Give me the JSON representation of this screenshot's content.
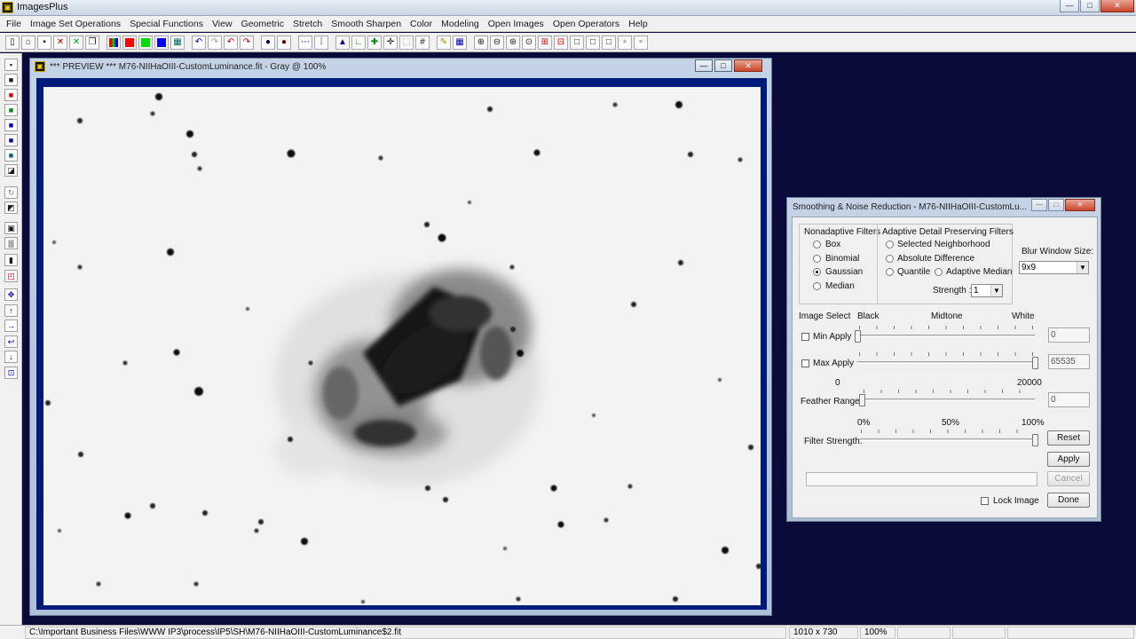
{
  "app": {
    "title": "ImagesPlus",
    "icon": "images-plus-logo-icon"
  },
  "menu": [
    "File",
    "Image Set Operations",
    "Special Functions",
    "View",
    "Geometric",
    "Stretch",
    "Smooth Sharpen",
    "Color",
    "Modeling",
    "Open Images",
    "Open Operators",
    "Help"
  ],
  "toolbar_colors": {
    "red": "#ff0000",
    "green": "#00dd00",
    "blue": "#0000ff"
  },
  "preview": {
    "title": "*** PREVIEW *** M76-NIIHaOIII-CustomLuminance.fit - Gray @ 100%"
  },
  "dialog": {
    "title": "Smoothing & Noise Reduction - M76-NIIHaOIII-CustomLu...",
    "nonadaptive": {
      "label": "Nonadaptive Filters",
      "options": [
        "Box",
        "Binomial",
        "Gaussian",
        "Median"
      ],
      "selected": "Gaussian"
    },
    "adaptive": {
      "label": "Adaptive Detail Preserving Filters",
      "options": [
        "Selected Neighborhood",
        "Absolute Difference",
        "Quantile",
        "Adaptive Median"
      ],
      "strength_label": "Strength :",
      "strength_value": "1"
    },
    "blur": {
      "label": "Blur Window Size:",
      "value": "9x9"
    },
    "image_select": {
      "label": "Image Select",
      "black": "Black",
      "midtone": "Midtone",
      "white": "White",
      "min_apply": {
        "label": "Min Apply",
        "value": "0",
        "checked": false,
        "level": 0
      },
      "max_apply": {
        "label": "Max Apply",
        "value": "65535",
        "checked": false,
        "level": 1.0
      }
    },
    "feather": {
      "label": "Feather Range:",
      "min": "0",
      "max": "20000",
      "value": "0",
      "level": 0
    },
    "filter_strength": {
      "label": "Filter Strength:",
      "p0": "0%",
      "p50": "50%",
      "p100": "100%",
      "level": 1.0
    },
    "buttons": {
      "reset": "Reset",
      "apply": "Apply",
      "cancel": "Cancel",
      "done": "Done"
    },
    "lock_image": {
      "label": "Lock Image",
      "checked": false
    }
  },
  "status": {
    "path": "C:\\Important Business Files\\WWW IP3\\process\\IP5\\SH\\M76-NIIHaOIII-CustomLuminance$2.fit",
    "dimensions": "1010 x 730",
    "zoom": "100%"
  }
}
